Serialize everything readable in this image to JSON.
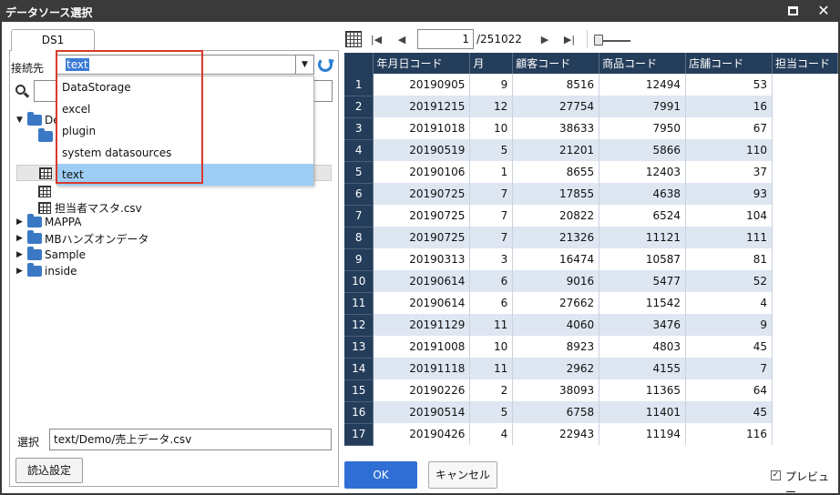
{
  "window": {
    "title": "データソース選択",
    "maximize_icon": "maximize-icon",
    "close_icon": "close-icon",
    "close_glyph": "✕"
  },
  "left": {
    "tab_label": "DS1",
    "connection_label": "接続先",
    "connection_value": "text",
    "dropdown_options": [
      "DataStorage",
      "excel",
      "plugin",
      "system datasources",
      "text"
    ],
    "dropdown_selected": "text",
    "tree": [
      {
        "label": "De",
        "expanded": true,
        "type": "folder"
      },
      {
        "label": "",
        "type": "folder"
      },
      {
        "label": "",
        "type": "file",
        "selected": true
      },
      {
        "label": "",
        "type": "file"
      },
      {
        "label": "担当者マスタ.csv",
        "type": "file"
      },
      {
        "label": "MAPPA",
        "type": "folder"
      },
      {
        "label": "MBハンズオンデータ",
        "type": "folder"
      },
      {
        "label": "Sample",
        "type": "folder"
      },
      {
        "label": "inside",
        "type": "folder"
      }
    ],
    "selection_label": "選択",
    "selection_value": "text/Demo/売上データ.csv",
    "load_settings_button": "読込設定"
  },
  "right": {
    "page_current": "1",
    "page_total": "/251022",
    "columns": [
      "年月日コード",
      "月",
      "顧客コード",
      "商品コード",
      "店舗コード",
      "担当コード"
    ],
    "rows": [
      [
        "1",
        "20190905",
        "9",
        "8516",
        "12494",
        "53"
      ],
      [
        "2",
        "20191215",
        "12",
        "27754",
        "7991",
        "16"
      ],
      [
        "3",
        "20191018",
        "10",
        "38633",
        "7950",
        "67"
      ],
      [
        "4",
        "20190519",
        "5",
        "21201",
        "5866",
        "110"
      ],
      [
        "5",
        "20190106",
        "1",
        "8655",
        "12403",
        "37"
      ],
      [
        "6",
        "20190725",
        "7",
        "17855",
        "4638",
        "93"
      ],
      [
        "7",
        "20190725",
        "7",
        "20822",
        "6524",
        "104"
      ],
      [
        "8",
        "20190725",
        "7",
        "21326",
        "11121",
        "111"
      ],
      [
        "9",
        "20190313",
        "3",
        "16474",
        "10587",
        "81"
      ],
      [
        "10",
        "20190614",
        "6",
        "9016",
        "5477",
        "52"
      ],
      [
        "11",
        "20190614",
        "6",
        "27662",
        "11542",
        "4"
      ],
      [
        "12",
        "20191129",
        "11",
        "4060",
        "3476",
        "9"
      ],
      [
        "13",
        "20191008",
        "10",
        "8923",
        "4803",
        "45"
      ],
      [
        "14",
        "20191118",
        "11",
        "2962",
        "4155",
        "7"
      ],
      [
        "15",
        "20190226",
        "2",
        "38093",
        "11365",
        "64"
      ],
      [
        "16",
        "20190514",
        "5",
        "6758",
        "11401",
        "45"
      ],
      [
        "17",
        "20190426",
        "4",
        "22943",
        "11194",
        "116"
      ]
    ],
    "ok_button": "OK",
    "cancel_button": "キャンセル",
    "preview_label": "プレビュー",
    "preview_checked": true
  }
}
